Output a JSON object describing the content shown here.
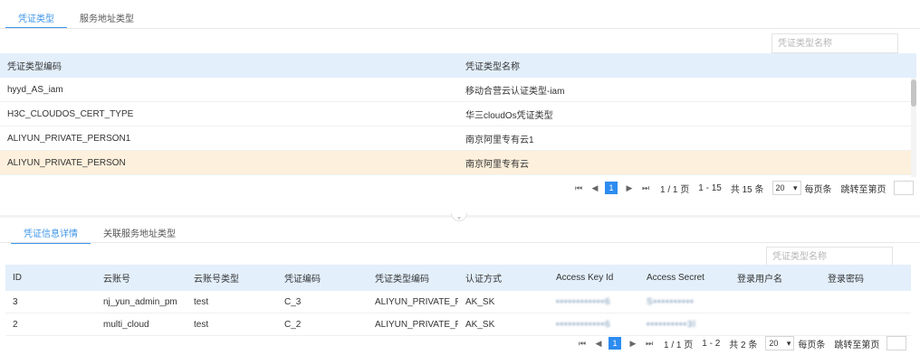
{
  "top": {
    "tabs": [
      "凭证类型",
      "服务地址类型"
    ],
    "search_placeholder": "凭证类型名称",
    "table": {
      "columns": [
        "凭证类型编码",
        "凭证类型名称"
      ],
      "rows": [
        [
          "hyyd_AS_iam",
          "移动合营云认证类型-iam"
        ],
        [
          "H3C_CLOUDOS_CERT_TYPE",
          "华三cloudOs凭证类型"
        ],
        [
          "ALIYUN_PRIVATE_PERSON1",
          "南京阿里专有云1"
        ],
        [
          "ALIYUN_PRIVATE_PERSON",
          "南京阿里专有云"
        ]
      ],
      "highlighted_row": 3
    },
    "pager": {
      "current": "1",
      "pages": "1 / 1 页",
      "range": "1 - 15",
      "total": "共 15 条",
      "page_size": "20",
      "per_page_label": "每页条",
      "jump_label": "跳转至第页"
    }
  },
  "bottom": {
    "tabs": [
      "凭证信息详情",
      "关联服务地址类型"
    ],
    "search_placeholder": "凭证类型名称",
    "table": {
      "columns": [
        "ID",
        "云账号",
        "云账号类型",
        "凭证编码",
        "凭证类型编码",
        "认证方式",
        "Access Key Id",
        "Access Secret",
        "登录用户名",
        "登录密码"
      ],
      "rows": [
        [
          "3",
          "nj_yun_admin_pm",
          "test",
          "C_3",
          "ALIYUN_PRIVATE_PI",
          "AK_SK",
          "••••••••••••6",
          "S••••••••••",
          "",
          ""
        ],
        [
          "2",
          "multi_cloud",
          "test",
          "C_2",
          "ALIYUN_PRIVATE_PI",
          "AK_SK",
          "••••••••••••6",
          "••••••••••3l",
          "",
          ""
        ]
      ]
    },
    "pager": {
      "current": "1",
      "pages": "1 / 1 页",
      "range": "1 - 2",
      "total": "共 2 条",
      "page_size": "20",
      "per_page_label": "每页条",
      "jump_label": "跳转至第页"
    }
  },
  "icons": {
    "first": "first-page-icon",
    "prev": "prev-page-icon",
    "next": "next-page-icon",
    "last": "last-page-icon",
    "collapse": "chevron-down-icon",
    "dropdown": "chevron-down-icon"
  },
  "colors": {
    "accent": "#3c94e8",
    "header_bg": "#e3effb",
    "highlight_row": "#fdf0dc",
    "page_active": "#2d8cf0"
  }
}
